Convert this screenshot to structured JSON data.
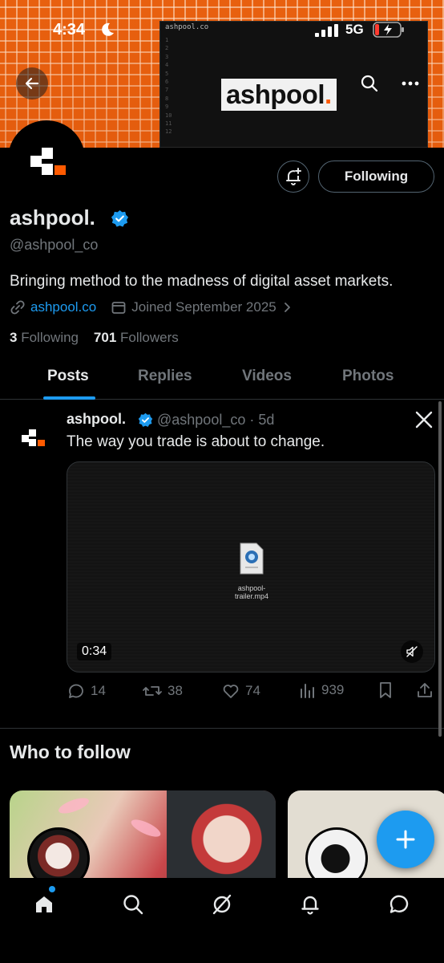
{
  "status_bar": {
    "time": "4:34",
    "network": "5G"
  },
  "banner": {
    "code_tab": "ashpool.co",
    "line_numbers": [
      "1",
      "2",
      "3",
      "4",
      "5",
      "6",
      "7",
      "8",
      "9",
      "10",
      "11",
      "12"
    ],
    "logo_text": "ashpool",
    "logo_dot": "."
  },
  "profile": {
    "display_name": "ashpool.",
    "handle": "@ashpool_co",
    "bio": "Bringing method to the madness of digital asset markets.",
    "link": "ashpool.co",
    "joined": "Joined September 2025",
    "following_count": "3",
    "following_label": "Following",
    "followers_count": "701",
    "followers_label": "Followers",
    "follow_button": "Following"
  },
  "tabs": [
    "Posts",
    "Replies",
    "Videos",
    "Photos"
  ],
  "post": {
    "name": "ashpool.",
    "handle_time": "@ashpool_co · 5d",
    "text": "The way you trade is about to change.",
    "file_name_line1": "ashpool-",
    "file_name_line2": "trailer.mp4",
    "duration": "0:34",
    "replies": "14",
    "reposts": "38",
    "likes": "74",
    "views": "939"
  },
  "who_to_follow": {
    "title": "Who to follow"
  },
  "colors": {
    "accent": "#1d9bf0",
    "banner": "#e8600f",
    "muted": "#71767b"
  }
}
